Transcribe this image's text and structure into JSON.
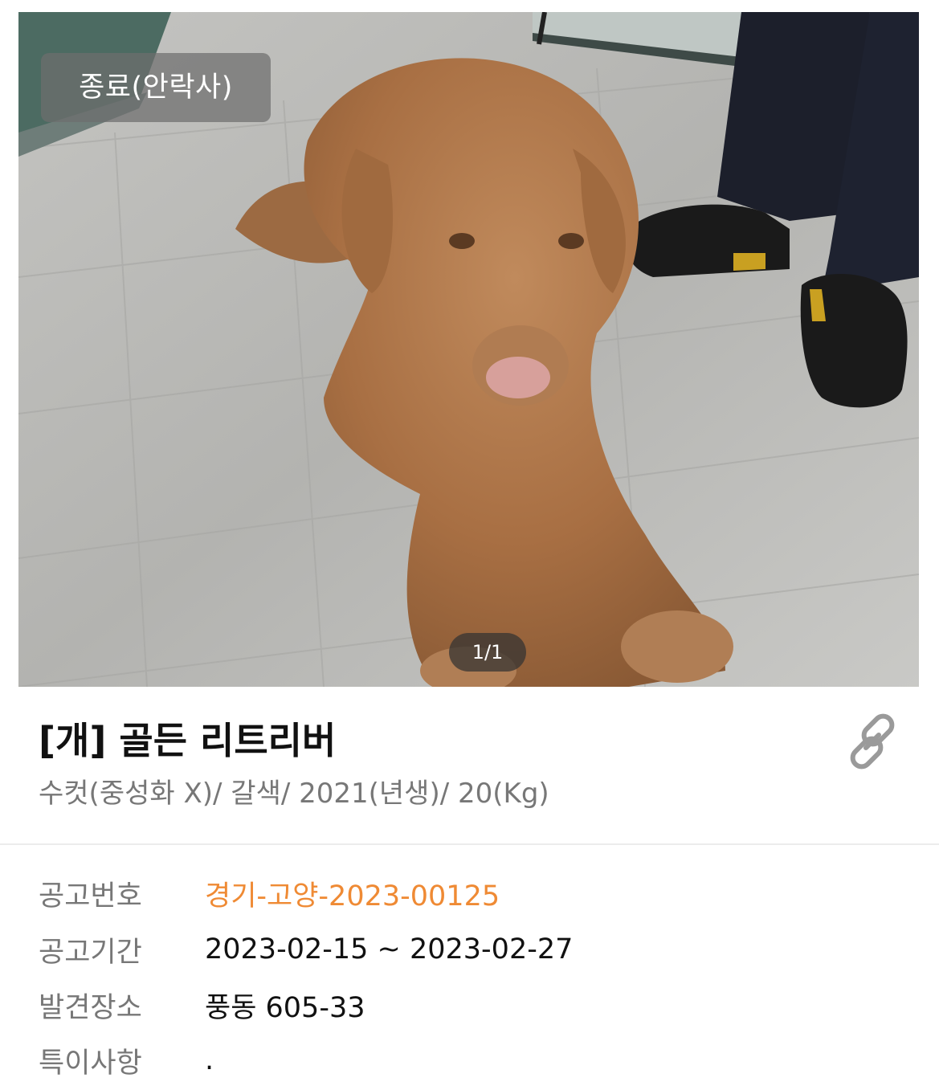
{
  "photo": {
    "status_badge": "종료(안락사)",
    "counter": "1/1"
  },
  "animal": {
    "title": "[개] 골든 리트리버",
    "summary": "수컷(중성화 X)/ 갈색/ 2021(년생)/ 20(Kg)"
  },
  "share": {
    "icon": "link-icon"
  },
  "details": [
    {
      "label": "공고번호",
      "value": "경기-고양-2023-00125"
    },
    {
      "label": "공고기간",
      "value": "2023-02-15 ~ 2023-02-27"
    },
    {
      "label": "발견장소",
      "value": "풍동 605-33"
    },
    {
      "label": "특이사항",
      "value": "."
    }
  ],
  "colors": {
    "accent": "#ef8a34",
    "label_gray": "#777777",
    "text": "#111111",
    "badge_bg": "rgba(110,110,110,0.72)"
  }
}
